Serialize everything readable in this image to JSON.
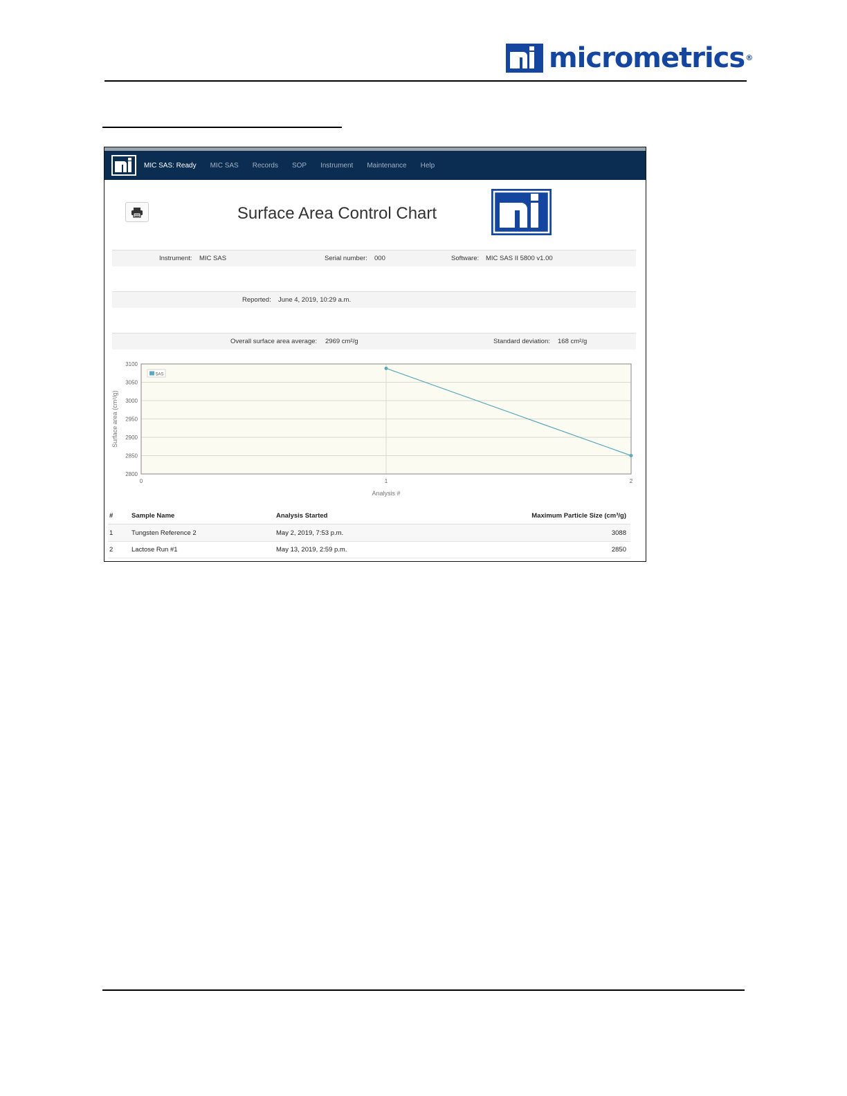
{
  "page": {
    "brand": "micrometrics",
    "brand_mark": "mi"
  },
  "navbar": {
    "status": "MIC SAS: Ready",
    "items": [
      "MIC SAS",
      "Records",
      "SOP",
      "Instrument",
      "Maintenance",
      "Help"
    ]
  },
  "report": {
    "title": "Surface Area Control Chart",
    "instrument_label": "Instrument:",
    "instrument_value": "MIC SAS",
    "serial_label": "Serial number:",
    "serial_value": "000",
    "software_label": "Software:",
    "software_value": "MIC SAS II 5800 v1.00",
    "reported_label": "Reported:",
    "reported_value": "June 4, 2019, 10:29 a.m.",
    "average_label": "Overall surface area average:",
    "average_value": "2969 cm²/g",
    "stddev_label": "Standard deviation:",
    "stddev_value": "168 cm²/g"
  },
  "chart_data": {
    "type": "line",
    "title": "",
    "xlabel": "Analysis #",
    "ylabel": "Surface area (cm²/g)",
    "xlim": [
      0,
      2
    ],
    "ylim": [
      2800,
      3100
    ],
    "xticks": [
      0,
      1,
      2
    ],
    "yticks": [
      3100,
      3050,
      3000,
      2950,
      2900,
      2850,
      2800
    ],
    "grid": true,
    "legend_position": "top-left",
    "series": [
      {
        "name": "SAS",
        "color": "#5aa9bd",
        "x": [
          1,
          2
        ],
        "y": [
          3088,
          2850
        ]
      }
    ]
  },
  "table": {
    "headers": [
      "#",
      "Sample Name",
      "Analysis Started",
      "Maximum Particle Size (cm³/g)"
    ],
    "rows": [
      [
        "1",
        "Tungsten Reference 2",
        "May 2, 2019, 7:53 p.m.",
        "3088"
      ],
      [
        "2",
        "Lactose Run #1",
        "May 13, 2019, 2:59 p.m.",
        "2850"
      ]
    ]
  },
  "colors": {
    "brand_blue": "#1446a0",
    "navbar": "#0c2d52",
    "series": "#5aa9bd",
    "plot_bg": "#fcfbf1"
  }
}
